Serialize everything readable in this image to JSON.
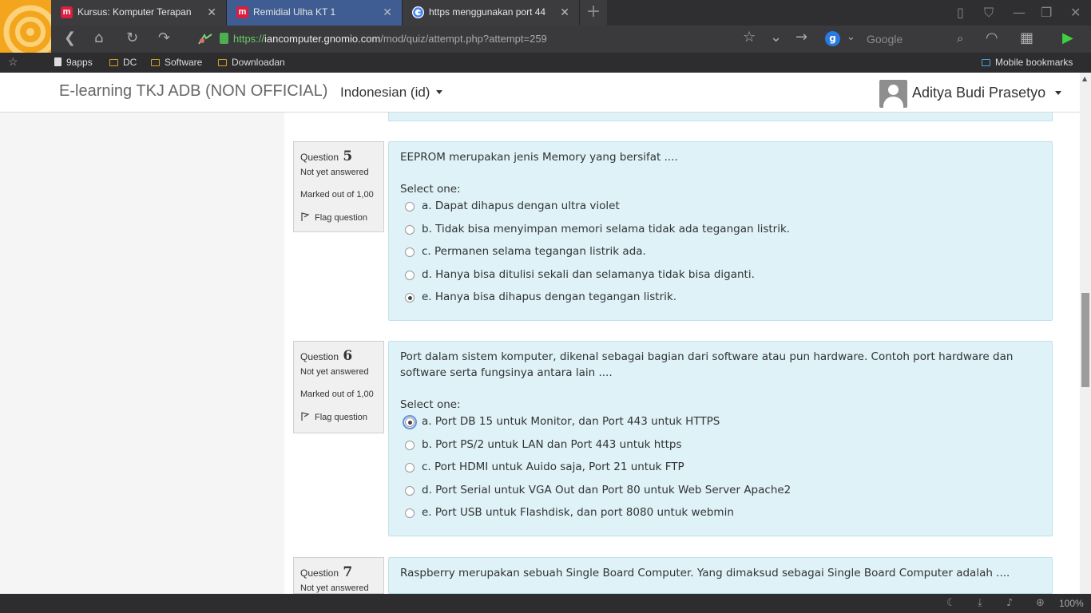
{
  "browser": {
    "tabs": [
      {
        "label": "Kursus: Komputer Terapan",
        "favicon": "moodle-icon",
        "active": false
      },
      {
        "label": "Remidial Ulha KT 1",
        "favicon": "moodle-icon",
        "active": true
      },
      {
        "label": "https menggunakan port 44",
        "favicon": "google-icon",
        "active": false
      }
    ],
    "favicon_letter": "m",
    "new_tab_label": "+",
    "url_scheme": "https://",
    "url_host": "iancomputer.gnomio.com",
    "url_path": "/mod/quiz/attempt.php?attempt=259",
    "search_placeholder": "Google",
    "search_engine_letter": "g",
    "bookmarks": [
      "9apps",
      "DC",
      "Software",
      "Downloadan"
    ],
    "mobile_bookmarks": "Mobile bookmarks",
    "zoom": "100%",
    "accent": "#3f5d92"
  },
  "page": {
    "site_name": "E-learning TKJ ADB (NON OFFICIAL)",
    "language": "Indonesian (id)",
    "user_name": "Aditya Budi Prasetyo"
  },
  "questions": [
    {
      "label": "Question",
      "number": "5",
      "state": "Not yet answered",
      "marks": "Marked out of 1,00",
      "flag": "Flag question",
      "text": "EEPROM merupakan jenis Memory yang bersifat ....",
      "select_label": "Select one:",
      "answers": [
        "a. Dapat dihapus dengan ultra violet",
        "b. Tidak bisa menyimpan memori selama tidak ada tegangan listrik.",
        "c. Permanen selama tegangan listrik ada.",
        "d. Hanya bisa ditulisi sekali dan selamanya tidak bisa diganti.",
        "e. Hanya bisa dihapus dengan tegangan listrik."
      ],
      "selected": 4
    },
    {
      "label": "Question",
      "number": "6",
      "state": "Not yet answered",
      "marks": "Marked out of 1,00",
      "flag": "Flag question",
      "text": "Port dalam sistem komputer, dikenal sebagai bagian dari software atau pun hardware. Contoh port hardware dan software serta fungsinya antara lain ....",
      "select_label": "Select one:",
      "answers": [
        "a. Port DB 15 untuk Monitor, dan Port 443 untuk HTTPS",
        "b. Port PS/2 untuk LAN dan Port 443 untuk https",
        "c. Port HDMI untuk Auido saja, Port 21 untuk FTP",
        "d. Port Serial untuk VGA Out dan Port 80 untuk Web Server Apache2",
        "e. Port USB untuk Flashdisk, dan port 8080 untuk webmin"
      ],
      "selected": 0
    },
    {
      "label": "Question",
      "number": "7",
      "state": "Not yet answered",
      "text": "Raspberry merupakan sebuah Single Board Computer. Yang dimaksud sebagai Single Board Computer adalah ...."
    }
  ]
}
